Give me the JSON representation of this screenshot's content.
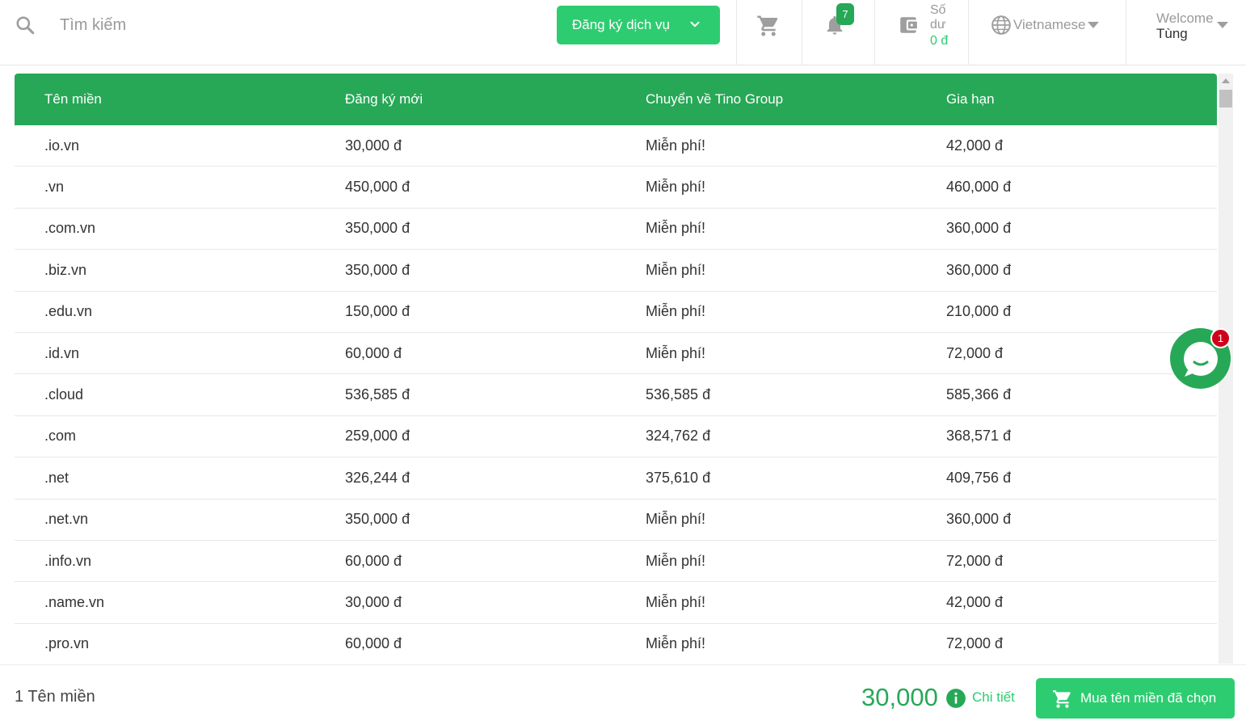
{
  "header": {
    "search_placeholder": "Tìm kiếm",
    "register_button": "Đăng ký dịch vụ",
    "notification_count": "7",
    "balance_label": "Số dư",
    "balance_value": "0 đ",
    "language": "Vietnamese",
    "welcome_label": "Welcome",
    "user_name": "Tùng"
  },
  "table": {
    "headers": [
      "Tên miền",
      "Đăng ký mới",
      "Chuyển về Tino Group",
      "Gia hạn"
    ],
    "rows": [
      [
        ".io.vn",
        "30,000 đ",
        "Miễn phí!",
        "42,000 đ"
      ],
      [
        ".vn",
        "450,000 đ",
        "Miễn phí!",
        "460,000 đ"
      ],
      [
        ".com.vn",
        "350,000 đ",
        "Miễn phí!",
        "360,000 đ"
      ],
      [
        ".biz.vn",
        "350,000 đ",
        "Miễn phí!",
        "360,000 đ"
      ],
      [
        ".edu.vn",
        "150,000 đ",
        "Miễn phí!",
        "210,000 đ"
      ],
      [
        ".id.vn",
        "60,000 đ",
        "Miễn phí!",
        "72,000 đ"
      ],
      [
        ".cloud",
        "536,585 đ",
        "536,585 đ",
        "585,366 đ"
      ],
      [
        ".com",
        "259,000 đ",
        "324,762 đ",
        "368,571 đ"
      ],
      [
        ".net",
        "326,244 đ",
        "375,610 đ",
        "409,756 đ"
      ],
      [
        ".net.vn",
        "350,000 đ",
        "Miễn phí!",
        "360,000 đ"
      ],
      [
        ".info.vn",
        "60,000 đ",
        "Miễn phí!",
        "72,000 đ"
      ],
      [
        ".name.vn",
        "30,000 đ",
        "Miễn phí!",
        "42,000 đ"
      ],
      [
        ".pro.vn",
        "60,000 đ",
        "Miễn phí!",
        "72,000 đ"
      ]
    ]
  },
  "chat": {
    "badge_count": "1"
  },
  "footer": {
    "selected_count": "1 Tên miền",
    "total": "30,000",
    "detail_link": "Chi tiết",
    "buy_button": "Mua tên miền đã chọn"
  },
  "colors": {
    "brand_green": "#27a857",
    "button_green": "#2ecc71",
    "badge_red": "#d0021b"
  },
  "icons": [
    "search-icon",
    "chevron-down-icon",
    "cart-icon",
    "bell-icon",
    "wallet-icon",
    "globe-icon",
    "caret-down-icon",
    "chat-icon",
    "info-icon"
  ]
}
